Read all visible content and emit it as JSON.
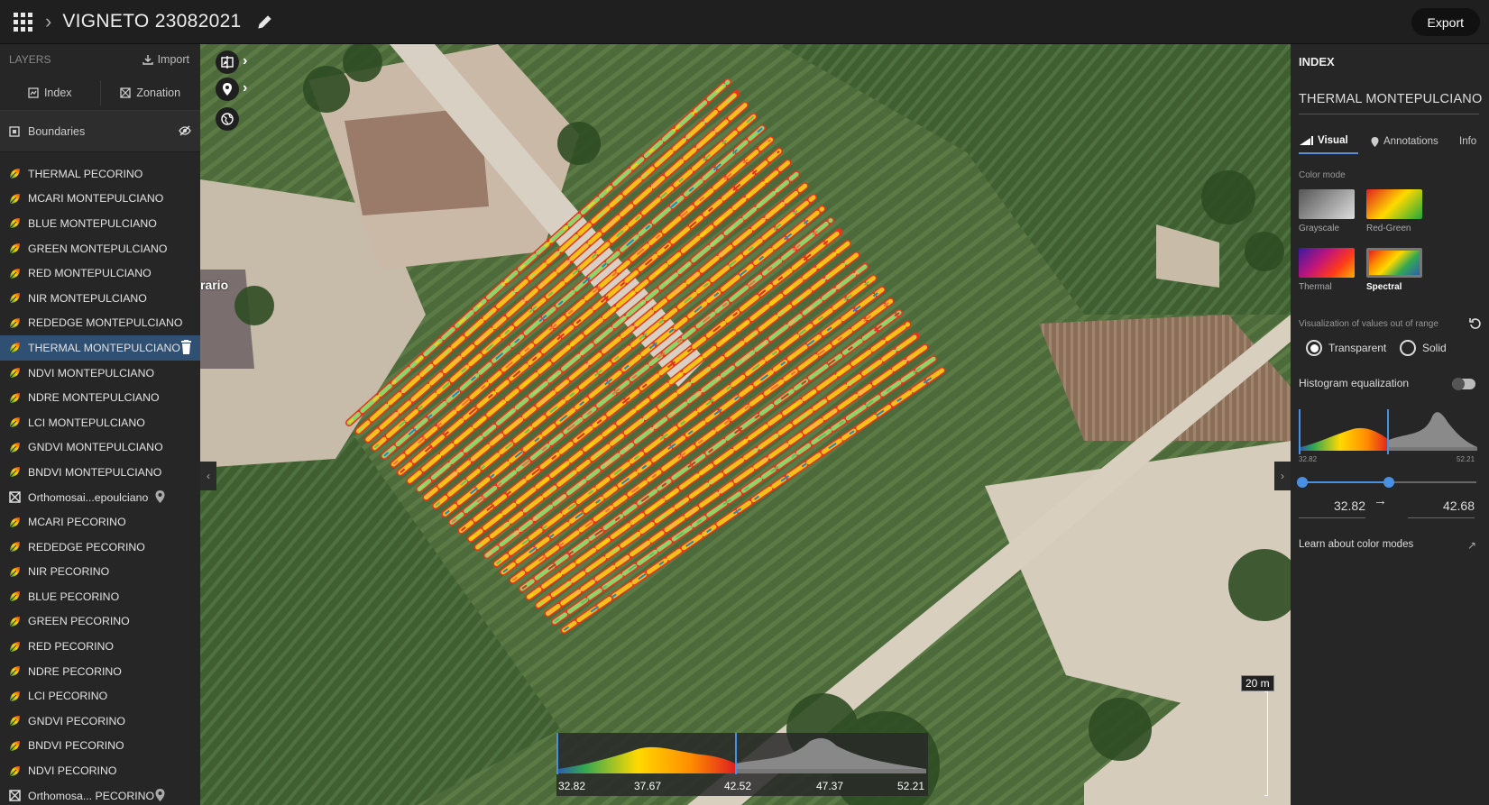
{
  "topbar": {
    "project_title": "VIGNETO 23082021",
    "export_label": "Export"
  },
  "left_panel": {
    "header": "LAYERS",
    "import_label": "Import",
    "tabs": [
      {
        "label": "Index"
      },
      {
        "label": "Zonation"
      }
    ],
    "boundaries_label": "Boundaries",
    "layers": [
      {
        "label": "THERMAL PECORINO",
        "kind": "index"
      },
      {
        "label": "MCARI MONTEPULCIANO",
        "kind": "index"
      },
      {
        "label": "BLUE MONTEPULCIANO",
        "kind": "index"
      },
      {
        "label": "GREEN MONTEPULCIANO",
        "kind": "index"
      },
      {
        "label": "RED MONTEPULCIANO",
        "kind": "index"
      },
      {
        "label": "NIR MONTEPULCIANO",
        "kind": "index"
      },
      {
        "label": "REDEDGE MONTEPULCIANO",
        "kind": "index"
      },
      {
        "label": "THERMAL MONTEPULCIANO",
        "kind": "index",
        "active": true
      },
      {
        "label": "NDVI MONTEPULCIANO",
        "kind": "index"
      },
      {
        "label": "NDRE MONTEPULCIANO",
        "kind": "index"
      },
      {
        "label": "LCI MONTEPULCIANO",
        "kind": "index"
      },
      {
        "label": "GNDVI MONTEPULCIANO",
        "kind": "index"
      },
      {
        "label": "BNDVI MONTEPULCIANO",
        "kind": "index"
      },
      {
        "label": "Orthomosai...epoulciano",
        "kind": "ortho"
      },
      {
        "label": "MCARI PECORINO",
        "kind": "index"
      },
      {
        "label": "REDEDGE PECORINO",
        "kind": "index"
      },
      {
        "label": "NIR PECORINO",
        "kind": "index"
      },
      {
        "label": "BLUE PECORINO",
        "kind": "index"
      },
      {
        "label": "GREEN PECORINO",
        "kind": "index"
      },
      {
        "label": "RED PECORINO",
        "kind": "index"
      },
      {
        "label": "NDRE PECORINO",
        "kind": "index"
      },
      {
        "label": "LCI PECORINO",
        "kind": "index"
      },
      {
        "label": "GNDVI PECORINO",
        "kind": "index"
      },
      {
        "label": "BNDVI PECORINO",
        "kind": "index"
      },
      {
        "label": "NDVI PECORINO",
        "kind": "index"
      },
      {
        "label": "Orthomosa... PECORINO",
        "kind": "ortho"
      }
    ]
  },
  "map": {
    "place_label": "rario",
    "scale_label": "20 m",
    "histogram_ticks": [
      "32.82",
      "37.67",
      "42.52",
      "47.37",
      "52.21"
    ]
  },
  "right_panel": {
    "title": "INDEX",
    "layer_name": "THERMAL MONTEPULCIANO",
    "tabs": [
      {
        "label": "Visual",
        "active": true
      },
      {
        "label": "Annotations"
      },
      {
        "label": "Info"
      }
    ],
    "color_mode_label": "Color mode",
    "color_modes": [
      {
        "label": "Grayscale"
      },
      {
        "label": "Red-Green"
      },
      {
        "label": "Thermal"
      },
      {
        "label": "Spectral",
        "selected": true
      }
    ],
    "out_of_range_label": "Visualization of values out of range",
    "radio_transparent": "Transparent",
    "radio_solid": "Solid",
    "histogram_eq_label": "Histogram equalization",
    "histogram_eq_on": false,
    "hist_min_label": "32.82",
    "hist_max_label": "52.21",
    "range_min": "32.82",
    "range_max": "42.68",
    "learn_label": "Learn about color modes"
  }
}
